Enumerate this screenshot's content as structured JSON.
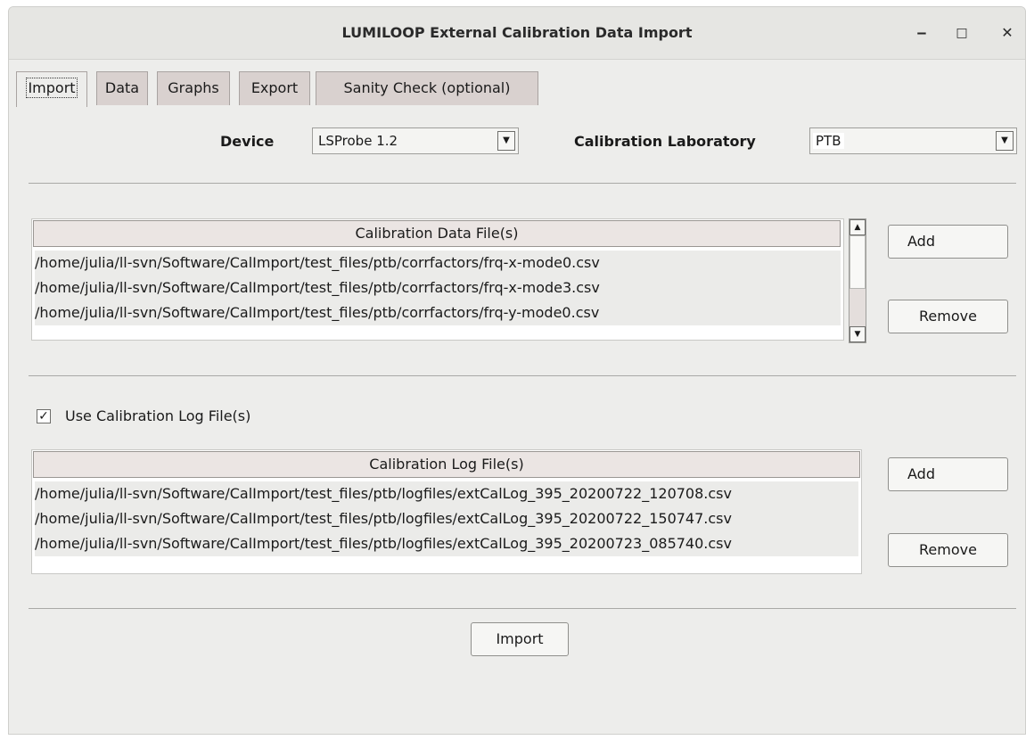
{
  "window": {
    "title": "LUMILOOP External Calibration Data Import",
    "minimize_glyph": "‒",
    "maximize_glyph": "□",
    "close_glyph": "✕"
  },
  "tabs": [
    {
      "label": "Import",
      "active": true
    },
    {
      "label": "Data"
    },
    {
      "label": "Graphs"
    },
    {
      "label": "Export"
    },
    {
      "label": "Sanity Check (optional)"
    }
  ],
  "device": {
    "label": "Device",
    "value": "LSProbe 1.2"
  },
  "laboratory": {
    "label": "Calibration Laboratory",
    "value": "PTB"
  },
  "calibration_data": {
    "header": "Calibration Data File(s)",
    "files": [
      "/home/julia/ll-svn/Software/CalImport/test_files/ptb/corrfactors/frq-x-mode0.csv",
      "/home/julia/ll-svn/Software/CalImport/test_files/ptb/corrfactors/frq-x-mode3.csv",
      "/home/julia/ll-svn/Software/CalImport/test_files/ptb/corrfactors/frq-y-mode0.csv"
    ],
    "add_label": "Add",
    "remove_label": "Remove"
  },
  "use_log": {
    "label": "Use Calibration Log File(s)",
    "checked": true,
    "check_glyph": "✓"
  },
  "calibration_log": {
    "header": "Calibration Log File(s)",
    "files": [
      "/home/julia/ll-svn/Software/CalImport/test_files/ptb/logfiles/extCalLog_395_20200722_120708.csv",
      "/home/julia/ll-svn/Software/CalImport/test_files/ptb/logfiles/extCalLog_395_20200722_150747.csv",
      "/home/julia/ll-svn/Software/CalImport/test_files/ptb/logfiles/extCalLog_395_20200723_085740.csv"
    ],
    "add_label": "Add",
    "remove_label": "Remove"
  },
  "import_button": "Import",
  "icons": {
    "dropdown": "▼",
    "scroll_up": "▲",
    "scroll_down": "▼"
  }
}
